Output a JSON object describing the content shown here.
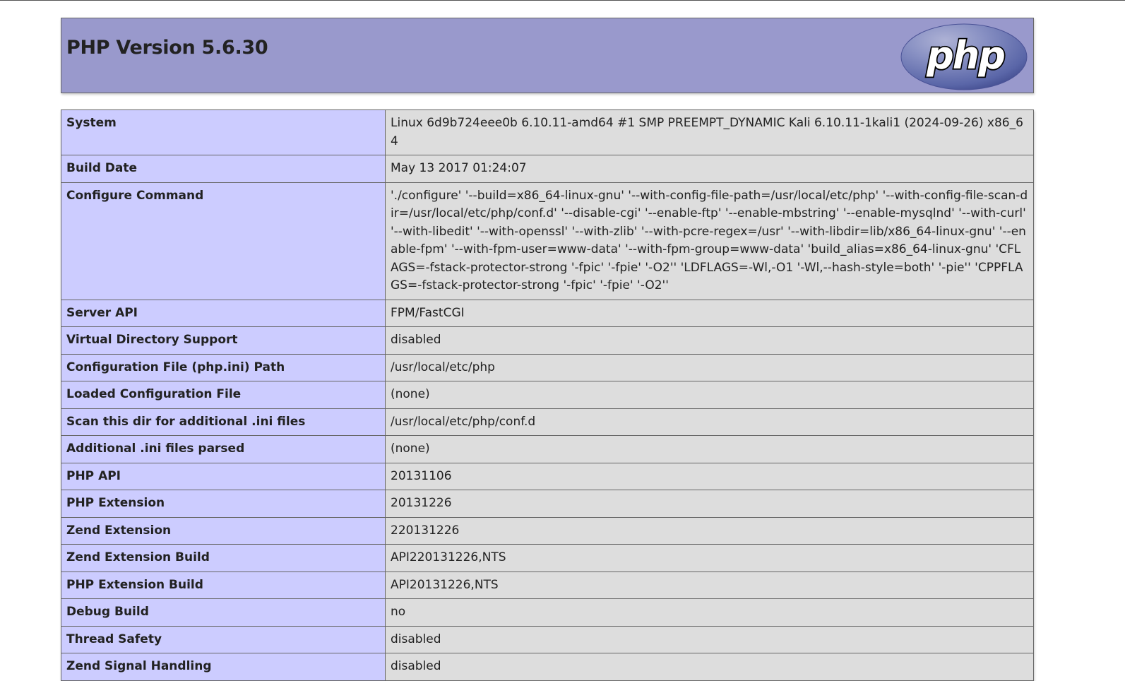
{
  "header": {
    "title": "PHP Version 5.6.30",
    "logo_text": "php",
    "colors": {
      "header_bg": "#9999cc",
      "logo_bg": "#6c7eb7",
      "label_bg": "#ccccff",
      "value_bg": "#dddddd"
    },
    "logo_icon": "php-logo-icon"
  },
  "rows": [
    {
      "label": "System",
      "value": "Linux 6d9b724eee0b 6.10.11-amd64 #1 SMP PREEMPT_DYNAMIC Kali 6.10.11-1kali1 (2024-09-26) x86_64"
    },
    {
      "label": "Build Date",
      "value": "May 13 2017 01:24:07"
    },
    {
      "label": "Configure Command",
      "value": "'./configure' '--build=x86_64-linux-gnu' '--with-config-file-path=/usr/local/etc/php' '--with-config-file-scan-dir=/usr/local/etc/php/conf.d' '--disable-cgi' '--enable-ftp' '--enable-mbstring' '--enable-mysqlnd' '--with-curl' '--with-libedit' '--with-openssl' '--with-zlib' '--with-pcre-regex=/usr' '--with-libdir=lib/x86_64-linux-gnu' '--enable-fpm' '--with-fpm-user=www-data' '--with-fpm-group=www-data' 'build_alias=x86_64-linux-gnu' 'CFLAGS=-fstack-protector-strong '-fpic' '-fpie' '-O2'' 'LDFLAGS=-Wl,-O1 '-Wl,--hash-style=both' '-pie'' 'CPPFLAGS=-fstack-protector-strong '-fpic' '-fpie' '-O2''"
    },
    {
      "label": "Server API",
      "value": "FPM/FastCGI"
    },
    {
      "label": "Virtual Directory Support",
      "value": "disabled"
    },
    {
      "label": "Configuration File (php.ini) Path",
      "value": "/usr/local/etc/php"
    },
    {
      "label": "Loaded Configuration File",
      "value": "(none)"
    },
    {
      "label": "Scan this dir for additional .ini files",
      "value": "/usr/local/etc/php/conf.d"
    },
    {
      "label": "Additional .ini files parsed",
      "value": "(none)"
    },
    {
      "label": "PHP API",
      "value": "20131106"
    },
    {
      "label": "PHP Extension",
      "value": "20131226"
    },
    {
      "label": "Zend Extension",
      "value": "220131226"
    },
    {
      "label": "Zend Extension Build",
      "value": "API220131226,NTS"
    },
    {
      "label": "PHP Extension Build",
      "value": "API20131226,NTS"
    },
    {
      "label": "Debug Build",
      "value": "no"
    },
    {
      "label": "Thread Safety",
      "value": "disabled"
    },
    {
      "label": "Zend Signal Handling",
      "value": "disabled"
    }
  ]
}
